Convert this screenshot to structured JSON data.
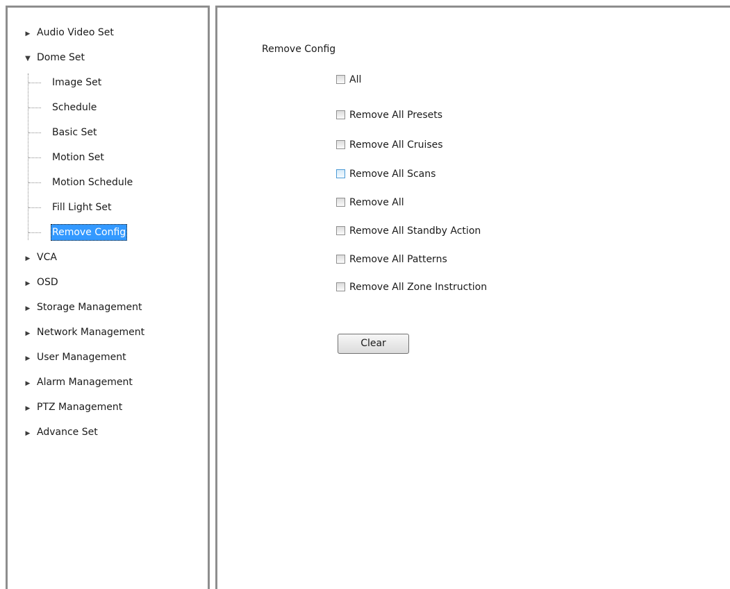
{
  "sidebar": {
    "items": [
      {
        "label": "Audio Video Set",
        "expanded": false
      },
      {
        "label": "Dome Set",
        "expanded": true,
        "children": [
          {
            "label": "Image Set"
          },
          {
            "label": "Schedule"
          },
          {
            "label": "Basic Set"
          },
          {
            "label": "Motion Set"
          },
          {
            "label": "Motion Schedule"
          },
          {
            "label": "Fill Light Set"
          },
          {
            "label": "Remove Config",
            "selected": true
          }
        ]
      },
      {
        "label": "VCA",
        "expanded": false
      },
      {
        "label": "OSD",
        "expanded": false
      },
      {
        "label": "Storage Management",
        "expanded": false
      },
      {
        "label": "Network Management",
        "expanded": false
      },
      {
        "label": "User Management",
        "expanded": false
      },
      {
        "label": "Alarm Management",
        "expanded": false
      },
      {
        "label": "PTZ Management",
        "expanded": false
      },
      {
        "label": "Advance Set",
        "expanded": false
      }
    ]
  },
  "main": {
    "title": "Remove Config",
    "checkboxes": [
      {
        "label": "All",
        "checked": false
      },
      {
        "label": "Remove All Presets",
        "checked": false
      },
      {
        "label": "Remove All Cruises",
        "checked": false
      },
      {
        "label": "Remove All Scans",
        "checked": false
      },
      {
        "label": "Remove All",
        "checked": false
      },
      {
        "label": "Remove All Standby Action",
        "checked": false
      },
      {
        "label": "Remove All Patterns",
        "checked": false
      },
      {
        "label": "Remove All Zone Instruction",
        "checked": false
      }
    ],
    "clear_label": "Clear"
  },
  "icons": {
    "collapsed": "triangle-right-icon",
    "expanded": "triangle-down-icon"
  },
  "colors": {
    "selection": "#3399ff",
    "pane_border": "#8e8e8e"
  }
}
